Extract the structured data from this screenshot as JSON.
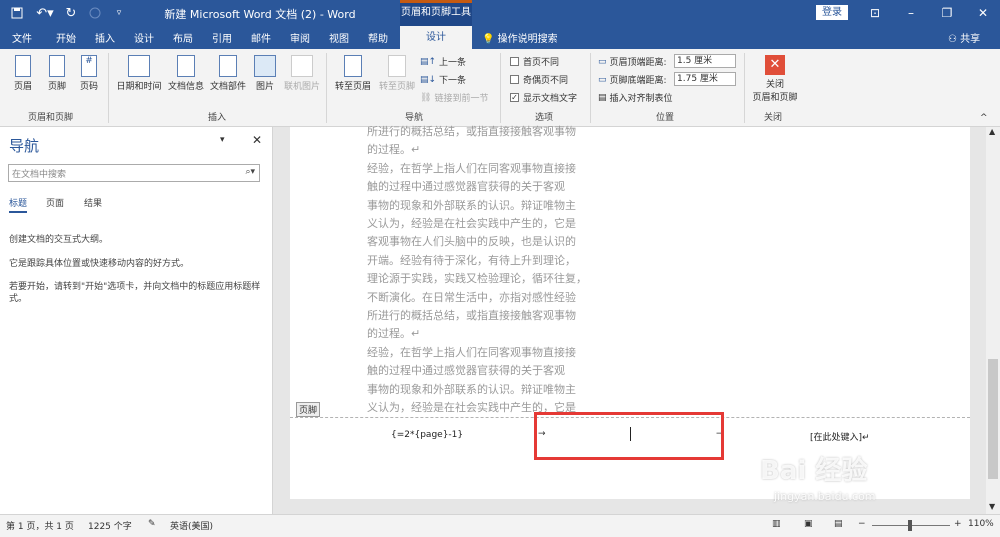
{
  "titlebar": {
    "title": "新建 Microsoft Word 文档 (2)  -  Word",
    "context_tab": "页眉和页脚工具",
    "login": "登录"
  },
  "tabs": [
    "文件",
    "开始",
    "插入",
    "设计",
    "布局",
    "引用",
    "邮件",
    "审阅",
    "视图",
    "帮助",
    "设计"
  ],
  "active_tab_index": 10,
  "tellme": "操作说明搜索",
  "share": "共享",
  "ribbon": {
    "header": "页眉",
    "footer": "页脚",
    "page_number": "页码",
    "group_hf": "页眉和页脚",
    "date_time": "日期和时间",
    "doc_info": "文档信息",
    "doc_parts": "文档部件",
    "picture": "图片",
    "online_picture": "联机图片",
    "group_insert": "插入",
    "goto_header": "转至页眉",
    "goto_footer": "转至页脚",
    "prev": "上一条",
    "next": "下一条",
    "link_prev": "链接到前一节",
    "group_nav": "导航",
    "diff_first": "首页不同",
    "diff_odd_even": "奇偶页不同",
    "show_doc_text": "显示文档文字",
    "group_options": "选项",
    "header_top_label": "页眉顶端距离:",
    "header_top_value": "1.5 厘米",
    "footer_bottom_label": "页脚底端距离:",
    "footer_bottom_value": "1.75 厘米",
    "insert_align_tab": "插入对齐制表位",
    "group_position": "位置",
    "close_hf": "关闭\n页眉和页脚",
    "close_label_1": "关闭",
    "close_label_2": "页眉和页脚",
    "group_close": "关闭"
  },
  "nav": {
    "title": "导航",
    "search_placeholder": "在文档中搜索",
    "tabs": [
      "标题",
      "页面",
      "结果"
    ],
    "text1": "创建文档的交互式大纲。",
    "text2": "它是跟踪具体位置或快速移动内容的好方式。",
    "text3": "若要开始，请转到\"开始\"选项卡，并向文档中的标题应用标题样式。"
  },
  "document": {
    "lines": [
      "所进行的概括总结，或指直接接触客观事物",
      "的过程。↵",
      "经验，在哲学上指人们在同客观事物直接接",
      "触的过程中通过感觉器官获得的关于客观",
      "事物的现象和外部联系的认识。辩证唯物主",
      "义认为，经验是在社会实践中产生的，它是",
      "客观事物在人们头脑中的反映，也是认识的",
      "开端。经验有待于深化，有待上升到理论，",
      "理论源于实践，实践又检验理论，循环往复，",
      "不断演化。在日常生活中，亦指对感性经验",
      "所进行的概括总结，或指直接接触客观事物",
      "的过程。↵",
      "经验，在哲学上指人们在同客观事物直接接",
      "触的过程中通过感觉器官获得的关于客观",
      "事物的现象和外部联系的认识。辩证唯物主",
      "义认为，经验是在社会实践中产生的，它是"
    ],
    "footer_tag": "页脚",
    "footer_field": "{=2*{page}-1}",
    "footer_placeholder": "[在此处键入]↵"
  },
  "status": {
    "page": "第 1 页，共 1 页",
    "words": "1225 个字",
    "lang": "英语(美国)",
    "zoom": "110%",
    "zoom_level": 110
  },
  "watermark": {
    "brand": "Bai 经验",
    "url": "jingyan.baidu.com"
  }
}
